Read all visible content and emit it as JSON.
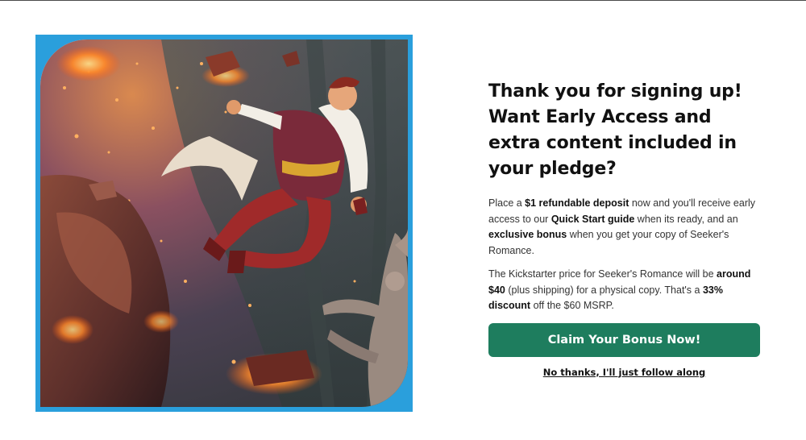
{
  "signup": {
    "headline": [
      "Thank you for signing up!",
      "Want Early Access and",
      "extra content included in",
      "your pledge?"
    ],
    "deposit_paragraph": {
      "t1": "Place a ",
      "b1": "$1 refundable deposit",
      "t2": " now and you'll receive early access to our ",
      "b2": "Quick Start guide",
      "t3": " when its ready, and an ",
      "b3": "exclusive bonus",
      "t4": " when you get your copy of Seeker's Romance."
    },
    "price_paragraph": {
      "t1": "The Kickstarter price for Seeker's Romance will be ",
      "b1": "around $40",
      "t2": " (plus shipping) for a physical copy. That's a ",
      "b2": "33% discount",
      "t3": " off the $60 MSRP."
    },
    "cta_label": "Claim Your Bonus Now!",
    "decline_label": "No thanks, I'll just follow along"
  },
  "colors": {
    "frame_blue": "#2a9fdc",
    "cta_green": "#1e7d5e",
    "text_dark": "#111111"
  }
}
